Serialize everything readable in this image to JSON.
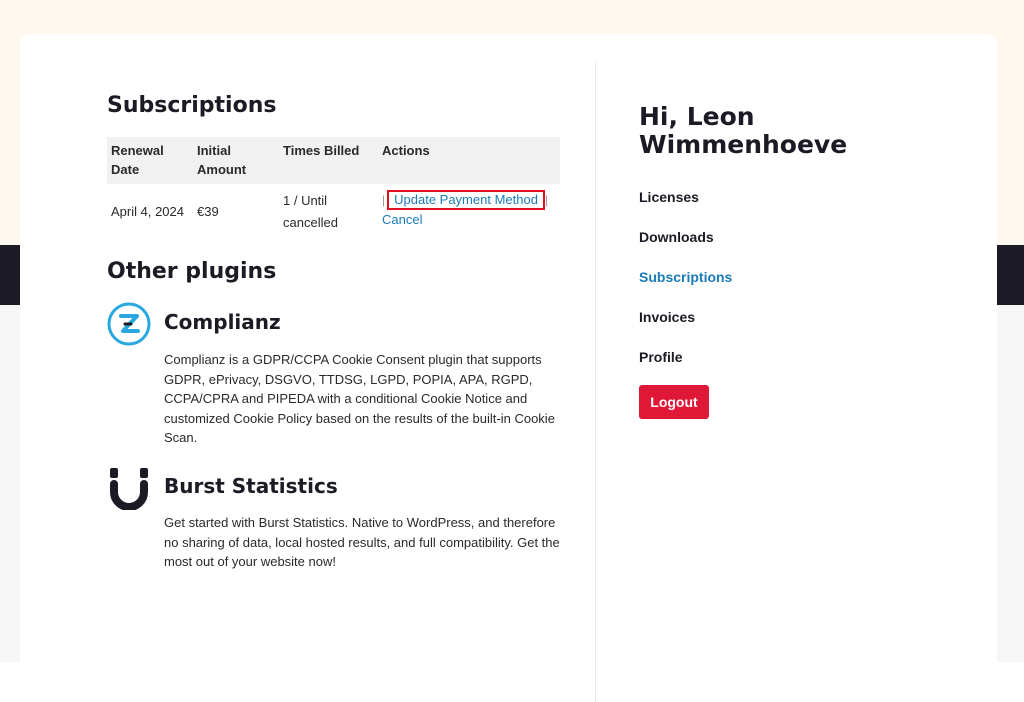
{
  "subscriptions": {
    "title": "Subscriptions",
    "headers": [
      "Renewal Date",
      "Initial Amount",
      "Times Billed",
      "Actions"
    ],
    "row": {
      "renewal_date": "April 4, 2024",
      "initial_amount": "€39",
      "times_billed": "1 / Until cancelled",
      "separator": "|",
      "update_action": "Update Payment Method",
      "cancel_action": "Cancel"
    }
  },
  "other_plugins": {
    "title": "Other plugins",
    "items": [
      {
        "name": "Complianz",
        "icon": "complianz-logo-icon",
        "accent": "#29a8e0",
        "description": "Complianz is a GDPR/CCPA Cookie Consent plugin that supports GDPR, ePrivacy, DSGVO, TTDSG, LGPD, POPIA, APA, RGPD, CCPA/CPRA and PIPEDA with a conditional Cookie Notice and customized Cookie Policy based on the results of the built-in Cookie Scan."
      },
      {
        "name": "Burst Statistics",
        "icon": "burst-statistics-logo-icon",
        "accent": "#1c1a24",
        "description": "Get started with Burst Statistics. Native to WordPress, and therefore no sharing of data, local hosted results, and full compatibility. Get the most out of your website now!"
      }
    ]
  },
  "sidebar": {
    "greeting": "Hi, Leon Wimmenhoeve",
    "nav": [
      {
        "label": "Licenses",
        "active": false
      },
      {
        "label": "Downloads",
        "active": false
      },
      {
        "label": "Subscriptions",
        "active": true
      },
      {
        "label": "Invoices",
        "active": false
      },
      {
        "label": "Profile",
        "active": false
      }
    ],
    "logout_label": "Logout"
  },
  "colors": {
    "link": "#1b7bb8",
    "logout_button": "#e01837",
    "highlight_box": "#e0101e",
    "dark_band": "#1c1a24",
    "top_background": "#fff8ee"
  }
}
